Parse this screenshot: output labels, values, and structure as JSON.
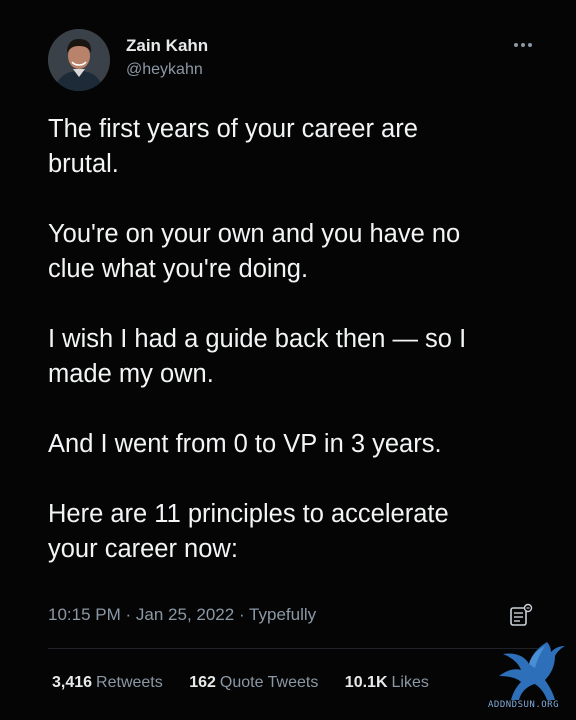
{
  "author": {
    "display_name": "Zain Kahn",
    "handle": "@heykahn"
  },
  "tweet": {
    "paragraphs": [
      "The first years of your career are\nbrutal.",
      "You're on your own and you have no\nclue what you're doing.",
      "I wish I had a guide back then — so I\nmade my own.",
      "And I went from 0 to VP in 3 years.",
      "Here are 11 principles to accelerate\nyour career now:"
    ],
    "time": "10:15 PM",
    "separator": "·",
    "date": "Jan 25, 2022",
    "source": "Typefully"
  },
  "stats": {
    "retweets": {
      "count": "3,416",
      "label": "Retweets"
    },
    "quote_tweets": {
      "count": "162",
      "label": "Quote Tweets"
    },
    "likes": {
      "count": "10.1K",
      "label": "Likes"
    }
  },
  "watermark": {
    "text": "ADDNDSUN.ORG",
    "icon": "pegasus-logo"
  },
  "icons": {
    "more": "more-horizontal-icon",
    "notes": "notes-icon"
  },
  "colors": {
    "background": "#000000",
    "primary_text": "#e7e9ea",
    "secondary_text": "#8b98a5",
    "watermark": "#2d6fb8"
  }
}
